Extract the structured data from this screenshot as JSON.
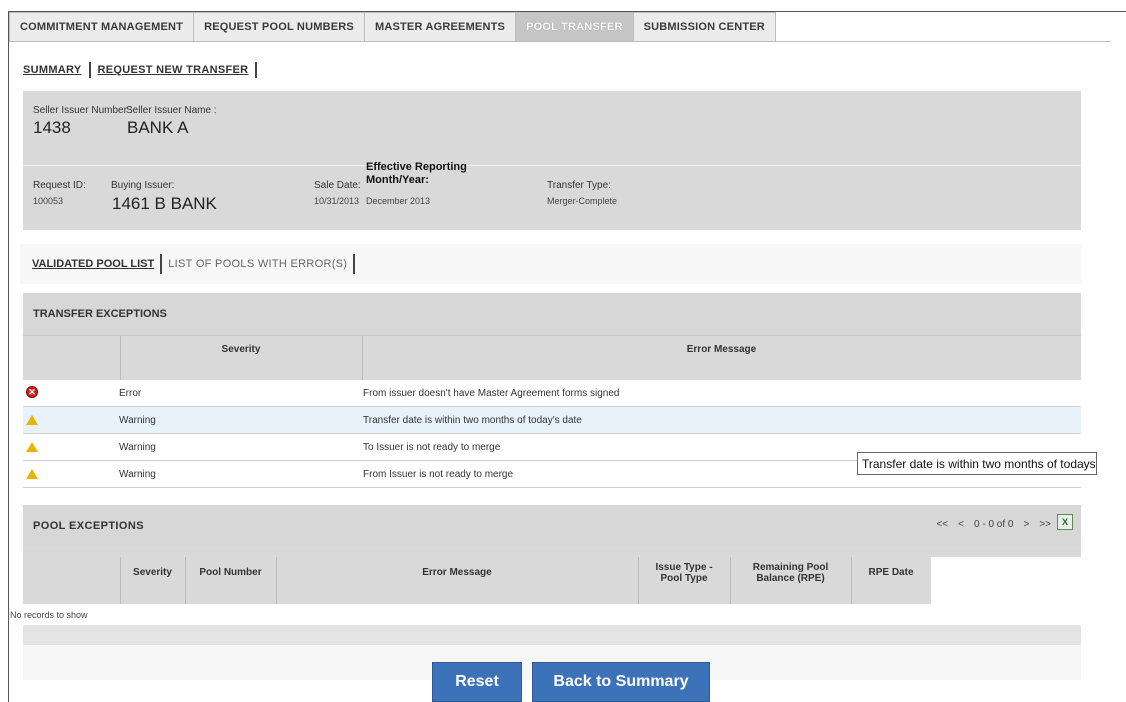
{
  "tabs": [
    {
      "label": "COMMITMENT MANAGEMENT",
      "active": false
    },
    {
      "label": "REQUEST POOL NUMBERS",
      "active": false
    },
    {
      "label": "MASTER AGREEMENTS",
      "active": false
    },
    {
      "label": "POOL TRANSFER",
      "active": true
    },
    {
      "label": "SUBMISSION CENTER",
      "active": false
    }
  ],
  "subnav": {
    "summary": "SUMMARY",
    "request_new": "REQUEST NEW TRANSFER"
  },
  "seller": {
    "number_label": "Seller Issuer Number :",
    "number": "1438",
    "name_label": "Seller Issuer Name :",
    "name": "BANK A"
  },
  "request": {
    "id_label": "Request ID:",
    "id": "100053",
    "buying_label": "Buying Issuer:",
    "buying": "1461 B BANK",
    "sale_date_label": "Sale Date:",
    "sale_date": "10/31/2013",
    "erm_label_1": "Effective Reporting",
    "erm_label_2": "Month/Year:",
    "erm": "December 2013",
    "transfer_type_label": "Transfer Type:",
    "transfer_type": "Merger-Complete"
  },
  "pool_tabs": {
    "validated": "VALIDATED POOL LIST",
    "errors": "LIST OF POOLS WITH ERROR(S)"
  },
  "transfer_exceptions": {
    "title": "TRANSFER EXCEPTIONS",
    "columns": [
      "Severity",
      "Error Message"
    ],
    "rows": [
      {
        "icon": "error-icon",
        "severity": "Error",
        "message": "From issuer doesn't have Master Agreement forms signed"
      },
      {
        "icon": "warning-icon",
        "severity": "Warning",
        "message": "Transfer date is within two months of today's date"
      },
      {
        "icon": "warning-icon",
        "severity": "Warning",
        "message": "To Issuer is not ready to merge"
      },
      {
        "icon": "warning-icon",
        "severity": "Warning",
        "message": "From Issuer is not ready to merge"
      }
    ]
  },
  "tooltip": "Transfer date is within two months of todays d",
  "pool_exceptions": {
    "title": "POOL EXCEPTIONS",
    "pager": {
      "first": "<<",
      "prev": "<",
      "range": "0 - 0 of 0",
      "next": ">",
      "last": ">>"
    },
    "columns": [
      "Severity",
      "Pool Number",
      "Error Message",
      "Issue Type - Pool Type",
      "Remaining Pool Balance (RPE)",
      "RPE Date"
    ],
    "empty": "No records to show"
  },
  "buttons": {
    "reset": "Reset",
    "back": "Back to Summary"
  },
  "colors": {
    "button": "#3c73b8",
    "panel": "#d9d9d9",
    "error": "#d32020",
    "warning": "#e8b400"
  }
}
